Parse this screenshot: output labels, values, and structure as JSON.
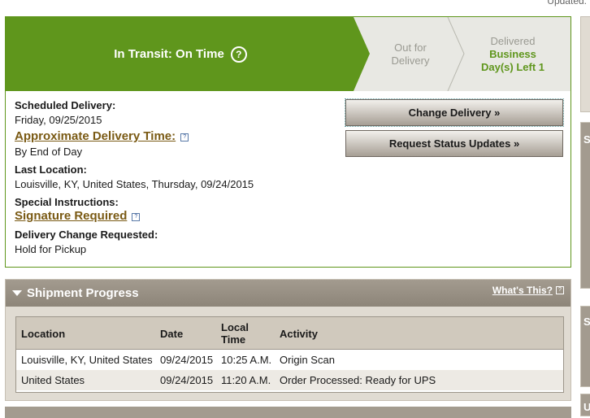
{
  "top": {
    "updated_text": "Updated:"
  },
  "status": {
    "current_stage": "In Transit: On Time",
    "help_glyph": "?",
    "stages": [
      {
        "line1": "Out for",
        "line2": "Delivery"
      },
      {
        "line1": "Delivered",
        "line2": "Business",
        "line3": "Day(s) Left 1"
      }
    ],
    "colors": {
      "accent_green": "#5f961c",
      "inactive": "#e8e8e3"
    }
  },
  "details": {
    "scheduled_label": "Scheduled Delivery:",
    "scheduled_value": "Friday, 09/25/2015",
    "approx_label": "Approximate Delivery Time:",
    "approx_value": "By End of Day",
    "last_location_label": "Last Location:",
    "last_location_value": "Louisville, KY, United States, Thursday, 09/24/2015",
    "special_label": "Special Instructions:",
    "special_link": "Signature Required",
    "change_label": "Delivery Change Requested:",
    "change_value": "Hold for Pickup"
  },
  "buttons": {
    "change_delivery": "Change Delivery »",
    "request_updates": "Request Status Updates »"
  },
  "progress": {
    "title": "Shipment Progress",
    "whats_this": "What's This?",
    "columns": [
      "Location",
      "Date",
      "Local",
      "Time",
      "Activity"
    ],
    "rows": [
      {
        "location": "Louisville, KY, United States",
        "date": "09/24/2015",
        "time": "10:25 A.M.",
        "activity": "Origin Scan"
      },
      {
        "location": "United States",
        "date": "09/24/2015",
        "time": "11:20 A.M.",
        "activity": "Order Processed: Ready for UPS"
      }
    ]
  },
  "edge_letters": [
    "S",
    "S",
    "U"
  ]
}
